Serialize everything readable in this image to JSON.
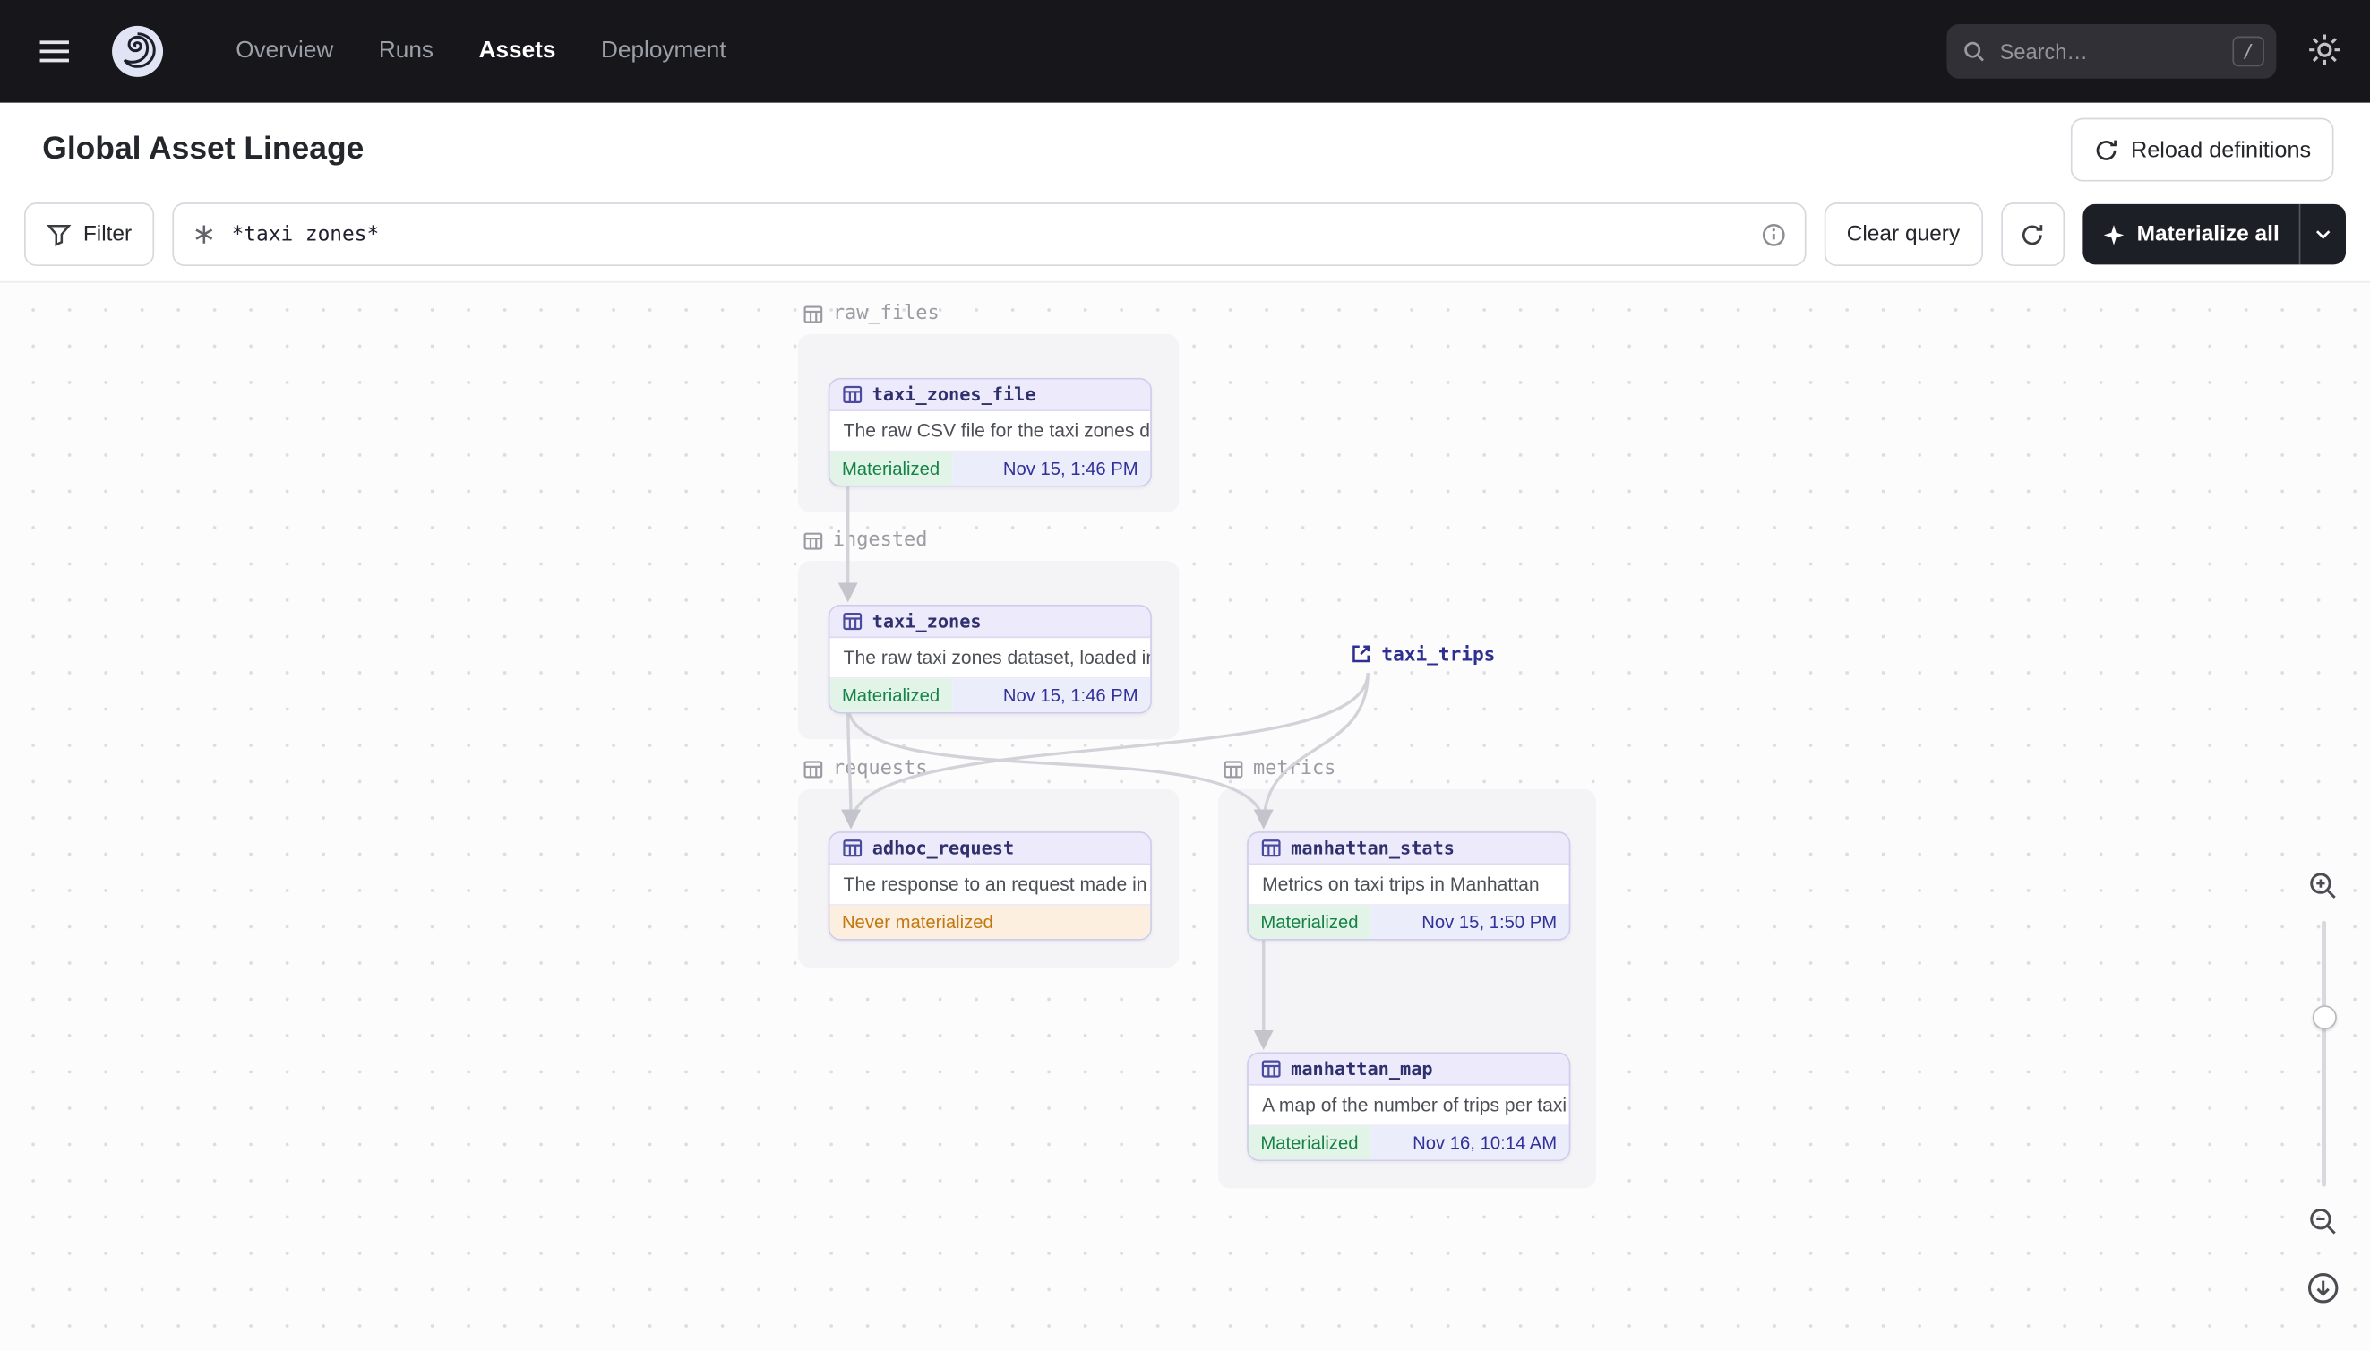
{
  "navbar": {
    "nav_items": [
      {
        "label": "Overview"
      },
      {
        "label": "Runs"
      },
      {
        "label": "Assets"
      },
      {
        "label": "Deployment"
      }
    ],
    "search": {
      "placeholder": "Search…",
      "shortcut": "/"
    }
  },
  "header": {
    "title": "Global Asset Lineage",
    "reload_button_label": "Reload definitions"
  },
  "toolbar": {
    "filter_label": "Filter",
    "query_value": "*taxi_zones*",
    "clear_query_label": "Clear query",
    "materialize_label": "Materialize all"
  },
  "graph": {
    "groups": [
      {
        "name": "raw_files"
      },
      {
        "name": "ingested"
      },
      {
        "name": "requests"
      },
      {
        "name": "metrics"
      }
    ],
    "nodes": [
      {
        "name": "taxi_zones_file",
        "description": "The raw CSV file for the taxi zones dat…",
        "status": "Materialized",
        "timestamp": "Nov 15, 1:46 PM"
      },
      {
        "name": "taxi_zones",
        "description": "The raw taxi zones dataset, loaded int…",
        "status": "Materialized",
        "timestamp": "Nov 15, 1:46 PM"
      },
      {
        "name": "adhoc_request",
        "description": "The response to an request made in th…",
        "status": "Never materialized",
        "timestamp": ""
      },
      {
        "name": "manhattan_stats",
        "description": "Metrics on taxi trips in Manhattan",
        "status": "Materialized",
        "timestamp": "Nov 15, 1:50 PM"
      },
      {
        "name": "manhattan_map",
        "description": "A map of the number of trips per taxi z…",
        "status": "Materialized",
        "timestamp": "Nov 16, 10:14 AM"
      }
    ],
    "external_asset": {
      "name": "taxi_trips"
    }
  },
  "colors": {
    "navbar_bg": "#17171b",
    "materialized_green": "#158246",
    "never_materialized_orange": "#c2770f",
    "asset_border_purple": "#cfcbeb",
    "asset_header_bg": "#edebfb",
    "timestamp_indigo": "#31319b",
    "edge_gray": "#d2d2d9"
  }
}
